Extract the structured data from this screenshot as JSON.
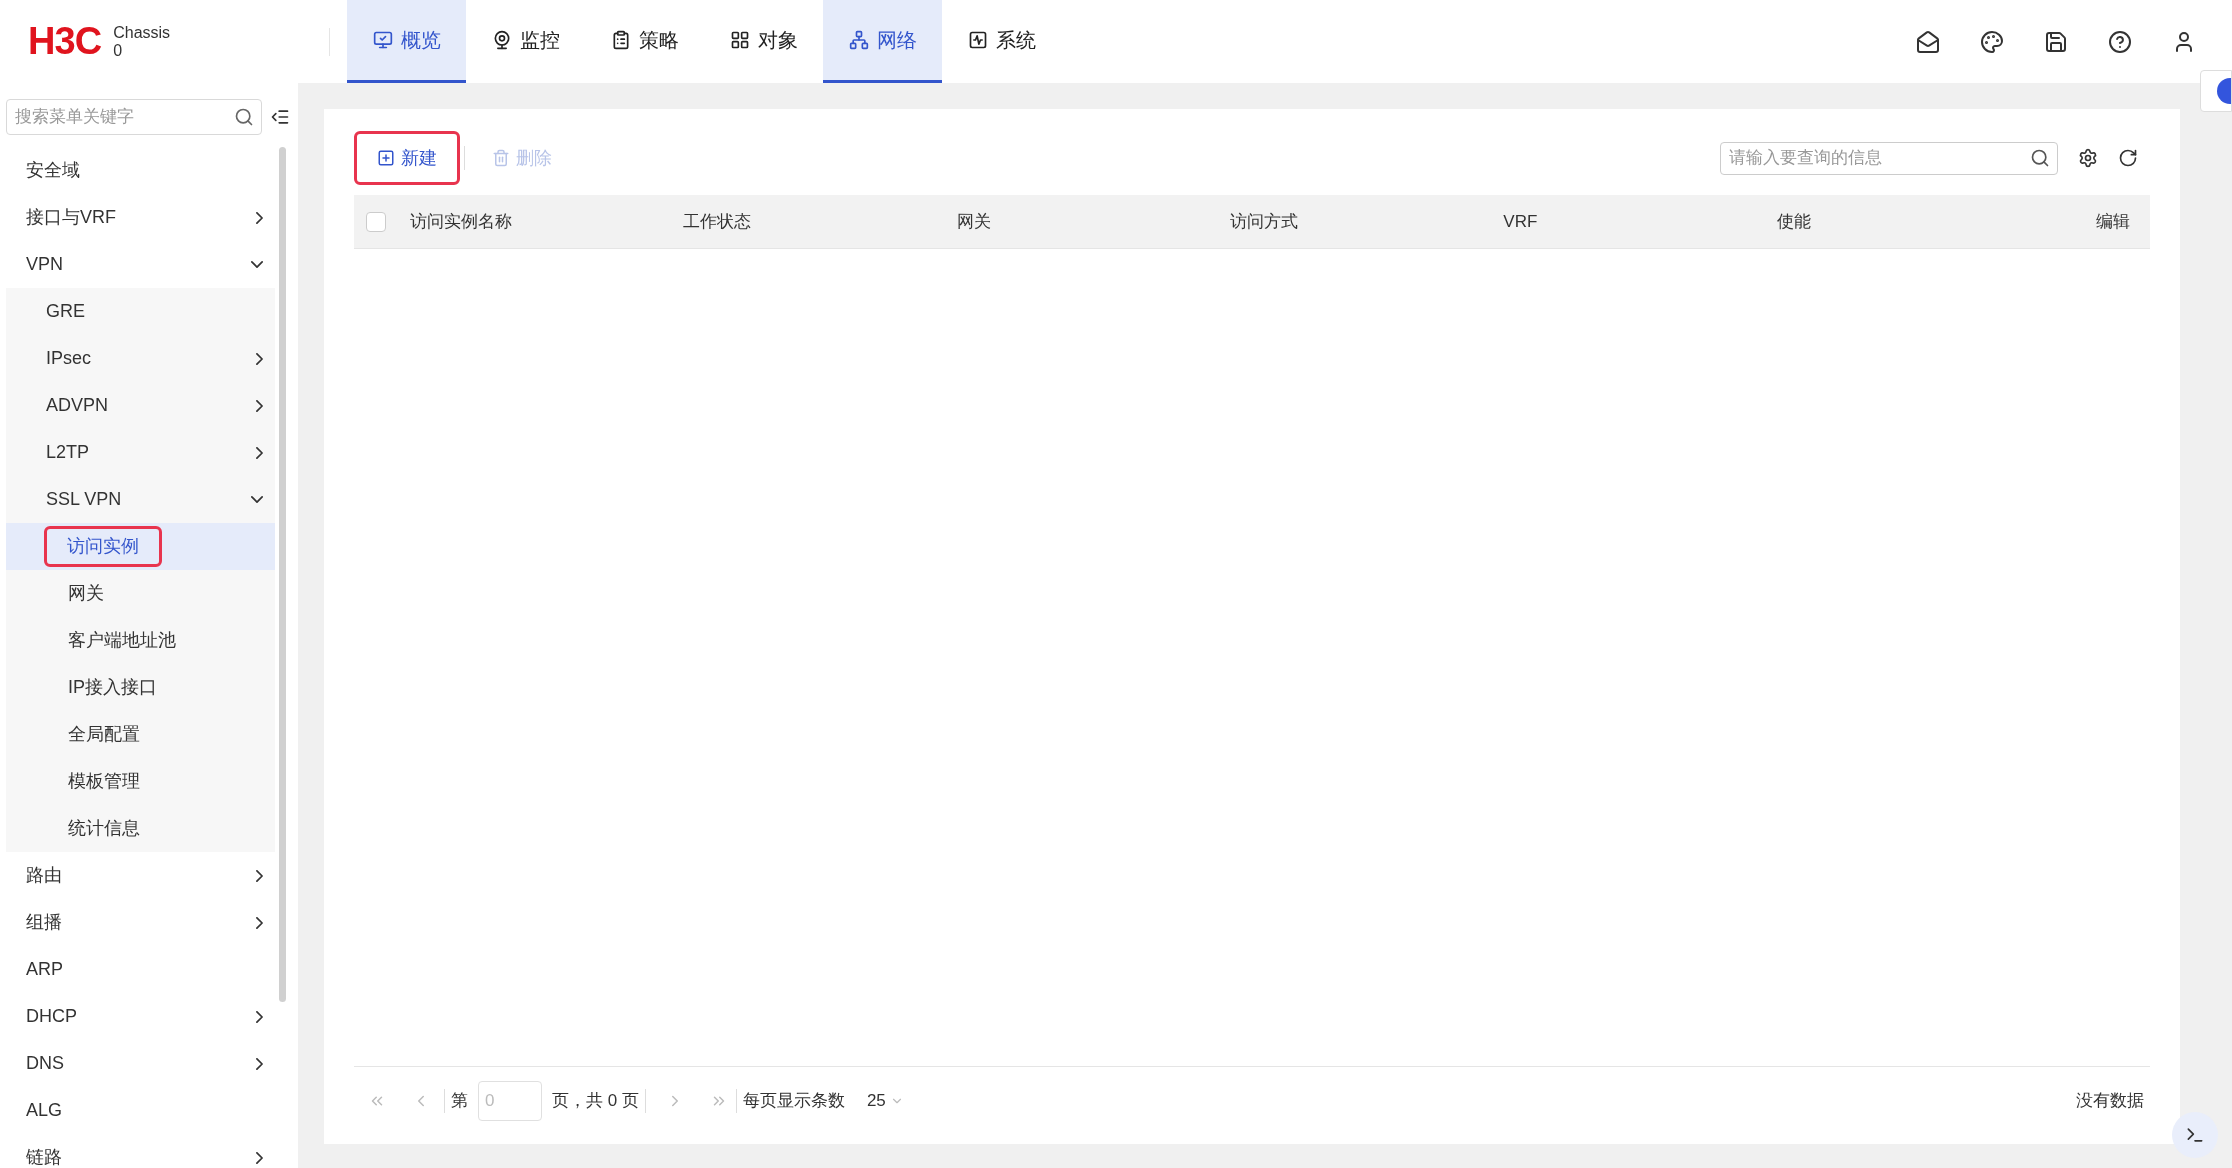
{
  "brand": {
    "logo": "H3C",
    "device": "Chassis",
    "slot": "0"
  },
  "nav": [
    {
      "label": "概览",
      "selected": true,
      "kind": "overview"
    },
    {
      "label": "监控",
      "selected": false,
      "kind": "monitor"
    },
    {
      "label": "策略",
      "selected": false,
      "kind": "policy"
    },
    {
      "label": "对象",
      "selected": false,
      "kind": "object"
    },
    {
      "label": "网络",
      "selected": true,
      "kind": "network"
    },
    {
      "label": "系统",
      "selected": false,
      "kind": "system"
    }
  ],
  "sidebar": {
    "search_placeholder": "搜索菜单关键字",
    "items": [
      {
        "label": "安全域",
        "kind": "page",
        "selected": false
      },
      {
        "label": "接口与VRF",
        "kind": "group",
        "expanded": false
      },
      {
        "label": "VPN",
        "kind": "group",
        "expanded": true,
        "children": [
          {
            "label": "GRE",
            "kind": "page",
            "selected": false
          },
          {
            "label": "IPsec",
            "kind": "group",
            "expanded": false
          },
          {
            "label": "ADVPN",
            "kind": "group",
            "expanded": false
          },
          {
            "label": "L2TP",
            "kind": "group",
            "expanded": false
          },
          {
            "label": "SSL VPN",
            "kind": "group",
            "expanded": true,
            "children": [
              {
                "label": "访问实例",
                "kind": "page",
                "selected": true,
                "highlighted": true
              },
              {
                "label": "网关",
                "kind": "page",
                "selected": false
              },
              {
                "label": "客户端地址池",
                "kind": "page",
                "selected": false
              },
              {
                "label": "IP接入接口",
                "kind": "page",
                "selected": false
              },
              {
                "label": "全局配置",
                "kind": "page",
                "selected": false
              },
              {
                "label": "模板管理",
                "kind": "page",
                "selected": false
              },
              {
                "label": "统计信息",
                "kind": "page",
                "selected": false
              }
            ]
          }
        ]
      },
      {
        "label": "路由",
        "kind": "group",
        "expanded": false
      },
      {
        "label": "组播",
        "kind": "group",
        "expanded": false
      },
      {
        "label": "ARP",
        "kind": "page",
        "selected": false
      },
      {
        "label": "DHCP",
        "kind": "group",
        "expanded": false
      },
      {
        "label": "DNS",
        "kind": "group",
        "expanded": false
      },
      {
        "label": "ALG",
        "kind": "page",
        "selected": false
      },
      {
        "label": "链路",
        "kind": "group",
        "expanded": false
      }
    ]
  },
  "toolbar": {
    "buttons": [
      {
        "label": "新建",
        "kind": "add",
        "disabled": false,
        "highlighted": true
      },
      {
        "label": "删除",
        "kind": "delete",
        "disabled": true,
        "highlighted": false
      }
    ],
    "search_placeholder": "请输入要查询的信息"
  },
  "table": {
    "select_all": {
      "checked": false
    },
    "columns": [
      "访问实例名称",
      "工作状态",
      "网关",
      "访问方式",
      "VRF",
      "使能",
      "编辑"
    ]
  },
  "pager": {
    "page_prefix": "第",
    "page_value": "0",
    "page_suffix": "页，共 0 页",
    "per_page_label": "每页显示条数",
    "per_page": "25",
    "status": "没有数据"
  }
}
